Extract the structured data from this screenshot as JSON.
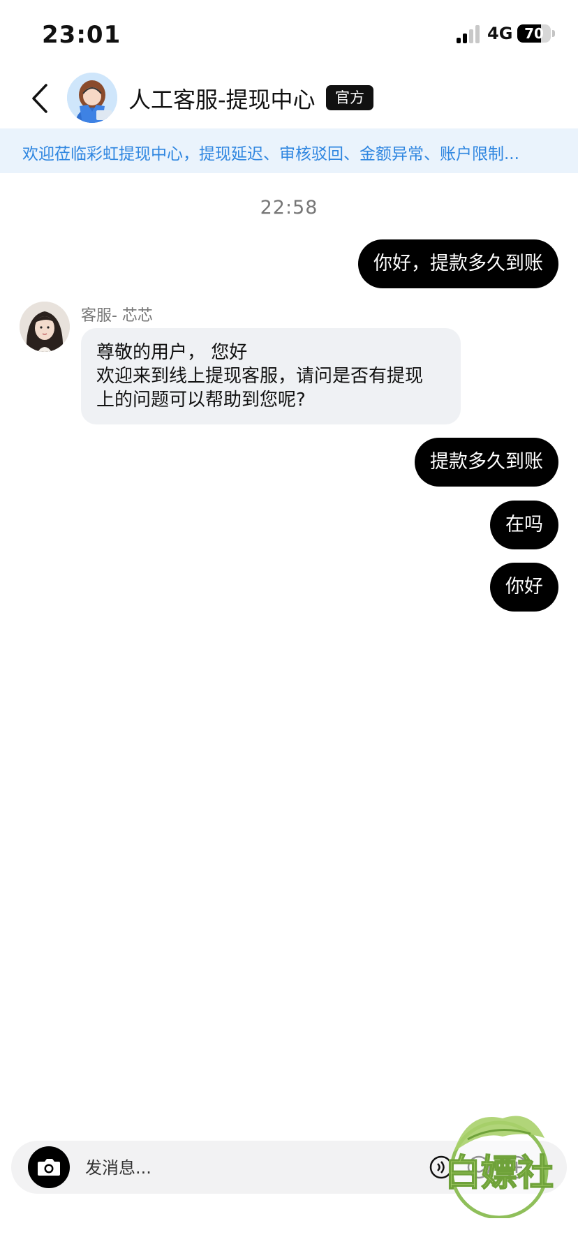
{
  "status_bar": {
    "time": "23:01",
    "network": "4G",
    "battery": "70",
    "battery_level": 0.7
  },
  "header": {
    "title": "人工客服-提现中心",
    "badge": "官方"
  },
  "notice": {
    "text": "欢迎莅临彩虹提现中心，提现延迟、审核驳回、金额异常、账户限制..."
  },
  "chat": {
    "timestamp": "22:58",
    "agent_name": "客服- 芯芯",
    "messages_out_1": "你好，提款多久到账",
    "agent_message": {
      "line1": "尊敬的用户，  您好",
      "line2": "欢迎来到线上提现客服，请问是否有提现",
      "line3": "上的问题可以帮助到您呢?"
    },
    "messages_out_2": "提款多久到账",
    "messages_out_3": "在吗",
    "messages_out_4": "你好"
  },
  "input_bar": {
    "placeholder": "发消息..."
  },
  "watermark": {
    "text": "白嫖社"
  },
  "colors": {
    "accent": "#2f86e0",
    "notice_bg": "#eaf3fc",
    "bubble_out": "#000000",
    "bubble_in": "#eff1f4"
  }
}
